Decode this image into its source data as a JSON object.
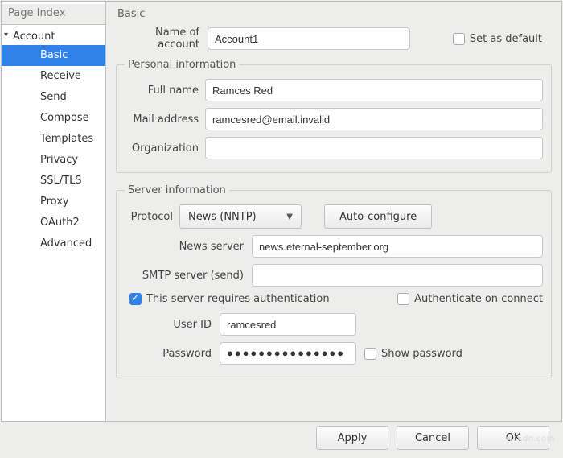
{
  "sidebar": {
    "title": "Page Index",
    "root_label": "Account",
    "items": [
      {
        "label": "Basic"
      },
      {
        "label": "Receive"
      },
      {
        "label": "Send"
      },
      {
        "label": "Compose"
      },
      {
        "label": "Templates"
      },
      {
        "label": "Privacy"
      },
      {
        "label": "SSL/TLS"
      },
      {
        "label": "Proxy"
      },
      {
        "label": "OAuth2"
      },
      {
        "label": "Advanced"
      }
    ],
    "selected_index": 0
  },
  "panel": {
    "title": "Basic"
  },
  "account": {
    "name_label": "Name of account",
    "name_value": "Account1",
    "set_default_label": "Set as default",
    "set_default_checked": false
  },
  "personal": {
    "legend": "Personal information",
    "full_name_label": "Full name",
    "full_name_value": "Ramces Red",
    "mail_label": "Mail address",
    "mail_value": "ramcesred@email.invalid",
    "org_label": "Organization",
    "org_value": ""
  },
  "server": {
    "legend": "Server information",
    "protocol_label": "Protocol",
    "protocol_value": "News (NNTP)",
    "autoconfig_label": "Auto-configure",
    "news_server_label": "News server",
    "news_server_value": "news.eternal-september.org",
    "smtp_label": "SMTP server (send)",
    "smtp_value": "",
    "auth_required_label": "This server requires authentication",
    "auth_required_checked": true,
    "auth_on_connect_label": "Authenticate on connect",
    "auth_on_connect_checked": false,
    "user_id_label": "User ID",
    "user_id_value": "ramcesred",
    "password_label": "Password",
    "password_display": "●●●●●●●●●●●●●●●",
    "show_password_label": "Show password",
    "show_password_checked": false
  },
  "buttons": {
    "apply": "Apply",
    "cancel": "Cancel",
    "ok": "OK"
  },
  "watermark": "wsxdn.com"
}
